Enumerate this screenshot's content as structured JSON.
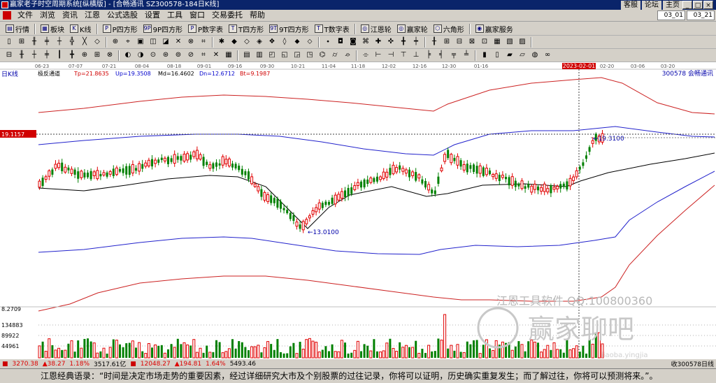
{
  "window": {
    "title": "赢家老子时空周期系统[纵横版] - [合畅通讯  SZ300578-184日K线]",
    "top_links": [
      "客服",
      "论坛",
      "主页"
    ]
  },
  "menu": [
    "文件",
    "浏览",
    "资讯",
    "江恩",
    "公式选股",
    "设置",
    "工具",
    "窗口",
    "交易委托",
    "帮助"
  ],
  "menu_boxes": [
    "03_01",
    "03_21"
  ],
  "toolbar1": [
    {
      "icon": "list-icon",
      "glyph": "▤",
      "label": "行情"
    },
    {
      "icon": "block-icon",
      "glyph": "▦",
      "label": "板块"
    },
    {
      "icon": "kline-icon",
      "glyph": "K",
      "label": "K线"
    },
    {
      "icon": "square-p-icon",
      "glyph": "P",
      "label": "P四方形"
    },
    {
      "icon": "square-9p-icon",
      "glyph": "9P",
      "label": "9P四方形"
    },
    {
      "icon": "square-pnum-icon",
      "glyph": "P",
      "label": "P数字表"
    },
    {
      "icon": "square-t-icon",
      "glyph": "T",
      "label": "T四方形"
    },
    {
      "icon": "square-9t-icon",
      "glyph": "9T",
      "label": "9T四方形"
    },
    {
      "icon": "square-tnum-icon",
      "glyph": "T",
      "label": "T数字表"
    },
    {
      "icon": "gann-wheel-icon",
      "glyph": "◎",
      "label": "江恩轮"
    },
    {
      "icon": "winner-wheel-icon",
      "glyph": "◎",
      "label": "赢家轮"
    },
    {
      "icon": "hexagon-icon",
      "glyph": "⬡",
      "label": "六角形"
    },
    {
      "icon": "service-icon",
      "glyph": "◉",
      "label": "赢家服务"
    }
  ],
  "chart_header": {
    "period": "日K线",
    "indicator": "极反通道",
    "tp": "Tp=21.8635",
    "up": "Up=19.3508",
    "md": "Md=16.4602",
    "dn": "Dn=12.6712",
    "bt": "Bt=9.1987",
    "stock": "300578  会畅通讯"
  },
  "date_labels": [
    "06-23",
    "07-07",
    "07-21",
    "08-04",
    "08-18",
    "09-01",
    "09-16",
    "09-30",
    "10-21",
    "11-04",
    "11-18",
    "12-02",
    "12-16",
    "12-30",
    "01-16",
    "2023-02-01",
    "02-20",
    "03-06",
    "03-20"
  ],
  "price_labels": {
    "crosshair_price": "19.1157",
    "low_marker": "13.0100",
    "high_marker": "19.3100",
    "axis_bottom": "8.2709"
  },
  "volume_labels": [
    "134883",
    "89922",
    "44961"
  ],
  "watermark": {
    "text1": "江恩工具软件   QQ:100800360",
    "text2": "赢家聊吧",
    "text3": "jiaoba.yingjia"
  },
  "status": {
    "sh_index": "3270.38",
    "sh_change": "▲38.27",
    "sh_pct": "1.18%",
    "sh_amount": "3517.61亿",
    "sz_index": "12048.27",
    "sz_change": "▲194.81",
    "sz_pct": "1.64%",
    "sz_amount": "5493.46",
    "right_text": "收300578日线"
  },
  "quote": "江恩经典语录：“时间是决定市场走势的重要因素，经过详细研究大市及个别股票的过往记录，你将可以证明，历史确实重复发生；而了解过往，你将可以预测将来。”。",
  "colors": {
    "up_candle": "#e00000",
    "down_candle": "#008000",
    "channel_outer": "#cc2222",
    "channel_inner": "#2222cc",
    "mid_line": "#000000",
    "title_bar": "#0a246a"
  },
  "chart_data": {
    "type": "candlestick",
    "channel_values": {
      "Tp": 21.8635,
      "Up": 19.3508,
      "Md": 16.4602,
      "Dn": 12.6712,
      "Bt": 9.1987
    },
    "marked_low": 13.01,
    "marked_high": 19.31,
    "volume_axis_ticks": [
      134883,
      89922,
      44961
    ],
    "price_axis_min_label": 8.2709
  }
}
